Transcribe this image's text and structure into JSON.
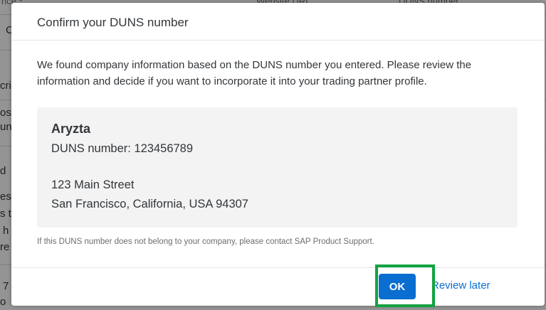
{
  "background": {
    "headers": [
      "nce",
      "Website URL",
      "DUNS number"
    ],
    "fragments": [
      "C",
      "cri",
      "os",
      "un",
      "d",
      "es",
      "s t",
      "h",
      "re",
      "7",
      "o"
    ]
  },
  "dialog": {
    "title": "Confirm your DUNS number",
    "intro": "We found company information based on the DUNS number you entered. Please review the information and decide if you want to incorporate it into your trading partner profile.",
    "company": {
      "name": "Aryzta",
      "duns_line": "DUNS number: 123456789",
      "address_line1": "123 Main Street",
      "address_line2": "San Francisco, California, USA 94307"
    },
    "note": "If this DUNS number does not belong to your company, please contact SAP Product Support.",
    "footer": {
      "ok_label": "OK",
      "review_later_label": "Review later"
    }
  },
  "colors": {
    "accent": "#0a6ed1",
    "highlight": "#12a340",
    "required": "#bb0000"
  }
}
